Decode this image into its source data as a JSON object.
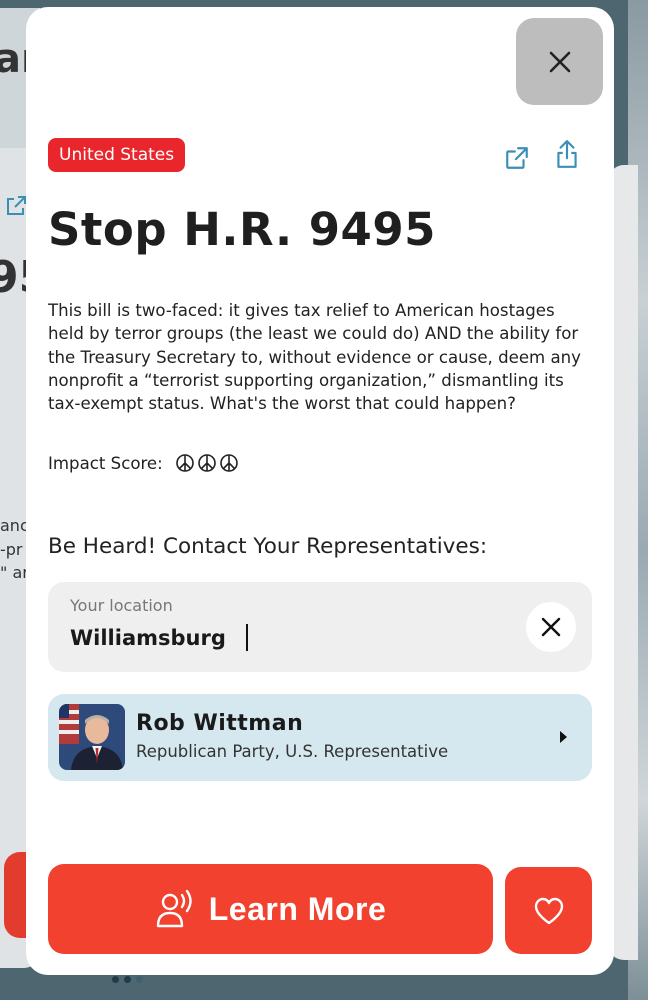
{
  "background": {
    "ghost_title": "ar",
    "ghost_number": "95",
    "ghost_lines": [
      "anc",
      "-pr",
      "\" ar"
    ]
  },
  "modal": {
    "country_badge": "United States",
    "title": "Stop H.R. 9495",
    "description": "This bill is two-faced: it gives tax relief to American hostages held by terror groups (the least we could do) AND the ability for the Treasury Secretary to, without evidence or cause, deem any nonprofit a “terrorist supporting organization,” dismantling its tax-exempt status. What's the worst that could happen?",
    "impact_label": "Impact Score:",
    "impact_score": 3,
    "contact_heading": "Be Heard! Contact Your Representatives:",
    "location": {
      "label": "Your location",
      "value": "Williamsburg"
    },
    "representative": {
      "name": "Rob Wittman",
      "role": "Republican Party, U.S. Representative"
    },
    "learn_more_label": "Learn More"
  },
  "colors": {
    "accent_red": "#f2412f",
    "badge_red": "#e8262c",
    "icon_teal": "#3a8fb5",
    "rep_card_bg": "#d5e8ef"
  },
  "pager": {
    "active_index": 1,
    "count": 3
  }
}
